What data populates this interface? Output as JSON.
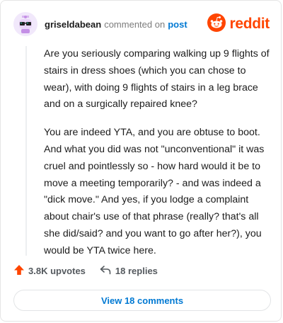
{
  "header": {
    "username": "griseldabean",
    "action": "commented on",
    "post_link": "post",
    "brand": "reddit",
    "avatar_icon": "snoo-avatar-icon",
    "brand_icon": "reddit-logo-icon"
  },
  "comment": {
    "paragraphs": [
      "Are you seriously comparing walking up 9 flights of stairs in dress shoes (which you can chose to wear), with doing 9 flights of stairs in a leg brace and on a surgically repaired knee?",
      "You are indeed YTA, and you are obtuse to boot. And what you did was not \"unconventional\" it was cruel and pointlessly so - how hard would it be to move a meeting temporarily? - and was indeed a \"dick move.\" And yes, if you lodge a complaint about chair's use of that phrase (really? that's all she did/said? and you want to go after her?), you would be YTA twice here."
    ]
  },
  "actions": {
    "upvotes": "3.8K upvotes",
    "replies": "18 replies",
    "upvote_icon": "upvote-arrow-icon",
    "reply_icon": "reply-arrow-icon"
  },
  "view_comments": {
    "label": "View 18 comments"
  },
  "colors": {
    "brand": "#ff4500",
    "link": "#0079d3",
    "muted": "#7c7c7c"
  }
}
